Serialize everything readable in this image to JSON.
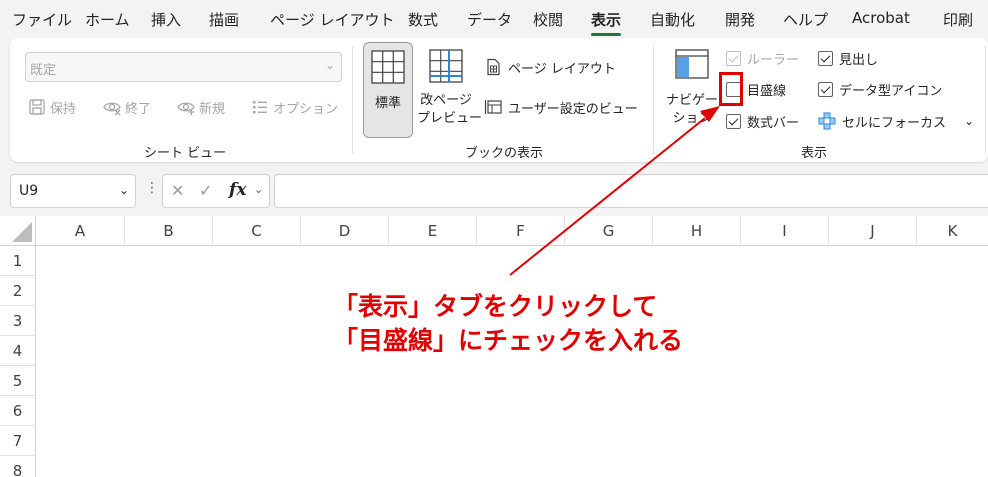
{
  "menu": {
    "tabs": [
      "ファイル",
      "ホーム",
      "挿入",
      "描画",
      "ページ レイアウト",
      "数式",
      "データ",
      "校閲",
      "表示",
      "自動化",
      "開発",
      "ヘルプ",
      "Acrobat",
      "印刷"
    ],
    "active_index": 8
  },
  "ribbon": {
    "sheet_view": {
      "select_value": "既定",
      "keep": "保持",
      "end": "終了",
      "new": "新規",
      "options": "オプション",
      "label": "シート ビュー"
    },
    "workbook_views": {
      "normal": "標準",
      "page_break_line1": "改ページ",
      "page_break_line2": "プレビュー",
      "page_layout": "ページ レイアウト",
      "custom_views": "ユーザー設定のビュー",
      "label": "ブックの表示"
    },
    "show": {
      "navigation_line1": "ナビゲー",
      "navigation_line2": "ション",
      "ruler": "ルーラー",
      "gridlines": "目盛線",
      "formula_bar": "数式バー",
      "headings": "見出し",
      "data_type_icons": "データ型アイコン",
      "focus_cell": "セルにフォーカス",
      "label": "表示",
      "ruler_checked": true,
      "gridlines_checked": false,
      "formula_bar_checked": true,
      "headings_checked": true,
      "data_type_icons_checked": true
    }
  },
  "formula_bar": {
    "name_box": "U9",
    "fx": "fx",
    "formula": ""
  },
  "grid": {
    "columns": [
      "A",
      "B",
      "C",
      "D",
      "E",
      "F",
      "G",
      "H",
      "I",
      "J",
      "K"
    ],
    "rows": [
      "1",
      "2",
      "3",
      "4",
      "5",
      "6",
      "7",
      "8"
    ]
  },
  "annotation": {
    "line1": "「表示」タブをクリックして",
    "line2": "「目盛線」にチェックを入れる",
    "color": "#e00000"
  }
}
